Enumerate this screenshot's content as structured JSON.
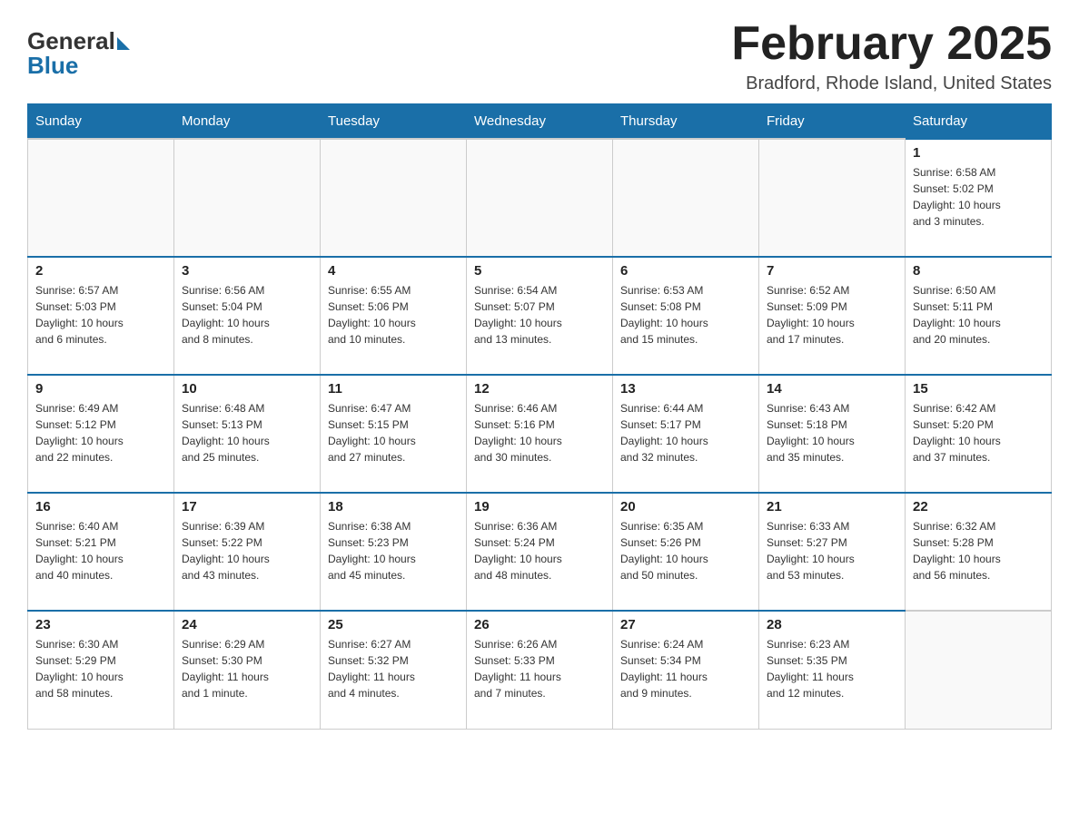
{
  "header": {
    "logo_general": "General",
    "logo_blue": "Blue",
    "month_title": "February 2025",
    "location": "Bradford, Rhode Island, United States"
  },
  "weekdays": [
    "Sunday",
    "Monday",
    "Tuesday",
    "Wednesday",
    "Thursday",
    "Friday",
    "Saturday"
  ],
  "weeks": [
    [
      {
        "day": "",
        "info": ""
      },
      {
        "day": "",
        "info": ""
      },
      {
        "day": "",
        "info": ""
      },
      {
        "day": "",
        "info": ""
      },
      {
        "day": "",
        "info": ""
      },
      {
        "day": "",
        "info": ""
      },
      {
        "day": "1",
        "info": "Sunrise: 6:58 AM\nSunset: 5:02 PM\nDaylight: 10 hours\nand 3 minutes."
      }
    ],
    [
      {
        "day": "2",
        "info": "Sunrise: 6:57 AM\nSunset: 5:03 PM\nDaylight: 10 hours\nand 6 minutes."
      },
      {
        "day": "3",
        "info": "Sunrise: 6:56 AM\nSunset: 5:04 PM\nDaylight: 10 hours\nand 8 minutes."
      },
      {
        "day": "4",
        "info": "Sunrise: 6:55 AM\nSunset: 5:06 PM\nDaylight: 10 hours\nand 10 minutes."
      },
      {
        "day": "5",
        "info": "Sunrise: 6:54 AM\nSunset: 5:07 PM\nDaylight: 10 hours\nand 13 minutes."
      },
      {
        "day": "6",
        "info": "Sunrise: 6:53 AM\nSunset: 5:08 PM\nDaylight: 10 hours\nand 15 minutes."
      },
      {
        "day": "7",
        "info": "Sunrise: 6:52 AM\nSunset: 5:09 PM\nDaylight: 10 hours\nand 17 minutes."
      },
      {
        "day": "8",
        "info": "Sunrise: 6:50 AM\nSunset: 5:11 PM\nDaylight: 10 hours\nand 20 minutes."
      }
    ],
    [
      {
        "day": "9",
        "info": "Sunrise: 6:49 AM\nSunset: 5:12 PM\nDaylight: 10 hours\nand 22 minutes."
      },
      {
        "day": "10",
        "info": "Sunrise: 6:48 AM\nSunset: 5:13 PM\nDaylight: 10 hours\nand 25 minutes."
      },
      {
        "day": "11",
        "info": "Sunrise: 6:47 AM\nSunset: 5:15 PM\nDaylight: 10 hours\nand 27 minutes."
      },
      {
        "day": "12",
        "info": "Sunrise: 6:46 AM\nSunset: 5:16 PM\nDaylight: 10 hours\nand 30 minutes."
      },
      {
        "day": "13",
        "info": "Sunrise: 6:44 AM\nSunset: 5:17 PM\nDaylight: 10 hours\nand 32 minutes."
      },
      {
        "day": "14",
        "info": "Sunrise: 6:43 AM\nSunset: 5:18 PM\nDaylight: 10 hours\nand 35 minutes."
      },
      {
        "day": "15",
        "info": "Sunrise: 6:42 AM\nSunset: 5:20 PM\nDaylight: 10 hours\nand 37 minutes."
      }
    ],
    [
      {
        "day": "16",
        "info": "Sunrise: 6:40 AM\nSunset: 5:21 PM\nDaylight: 10 hours\nand 40 minutes."
      },
      {
        "day": "17",
        "info": "Sunrise: 6:39 AM\nSunset: 5:22 PM\nDaylight: 10 hours\nand 43 minutes."
      },
      {
        "day": "18",
        "info": "Sunrise: 6:38 AM\nSunset: 5:23 PM\nDaylight: 10 hours\nand 45 minutes."
      },
      {
        "day": "19",
        "info": "Sunrise: 6:36 AM\nSunset: 5:24 PM\nDaylight: 10 hours\nand 48 minutes."
      },
      {
        "day": "20",
        "info": "Sunrise: 6:35 AM\nSunset: 5:26 PM\nDaylight: 10 hours\nand 50 minutes."
      },
      {
        "day": "21",
        "info": "Sunrise: 6:33 AM\nSunset: 5:27 PM\nDaylight: 10 hours\nand 53 minutes."
      },
      {
        "day": "22",
        "info": "Sunrise: 6:32 AM\nSunset: 5:28 PM\nDaylight: 10 hours\nand 56 minutes."
      }
    ],
    [
      {
        "day": "23",
        "info": "Sunrise: 6:30 AM\nSunset: 5:29 PM\nDaylight: 10 hours\nand 58 minutes."
      },
      {
        "day": "24",
        "info": "Sunrise: 6:29 AM\nSunset: 5:30 PM\nDaylight: 11 hours\nand 1 minute."
      },
      {
        "day": "25",
        "info": "Sunrise: 6:27 AM\nSunset: 5:32 PM\nDaylight: 11 hours\nand 4 minutes."
      },
      {
        "day": "26",
        "info": "Sunrise: 6:26 AM\nSunset: 5:33 PM\nDaylight: 11 hours\nand 7 minutes."
      },
      {
        "day": "27",
        "info": "Sunrise: 6:24 AM\nSunset: 5:34 PM\nDaylight: 11 hours\nand 9 minutes."
      },
      {
        "day": "28",
        "info": "Sunrise: 6:23 AM\nSunset: 5:35 PM\nDaylight: 11 hours\nand 12 minutes."
      },
      {
        "day": "",
        "info": ""
      }
    ]
  ]
}
